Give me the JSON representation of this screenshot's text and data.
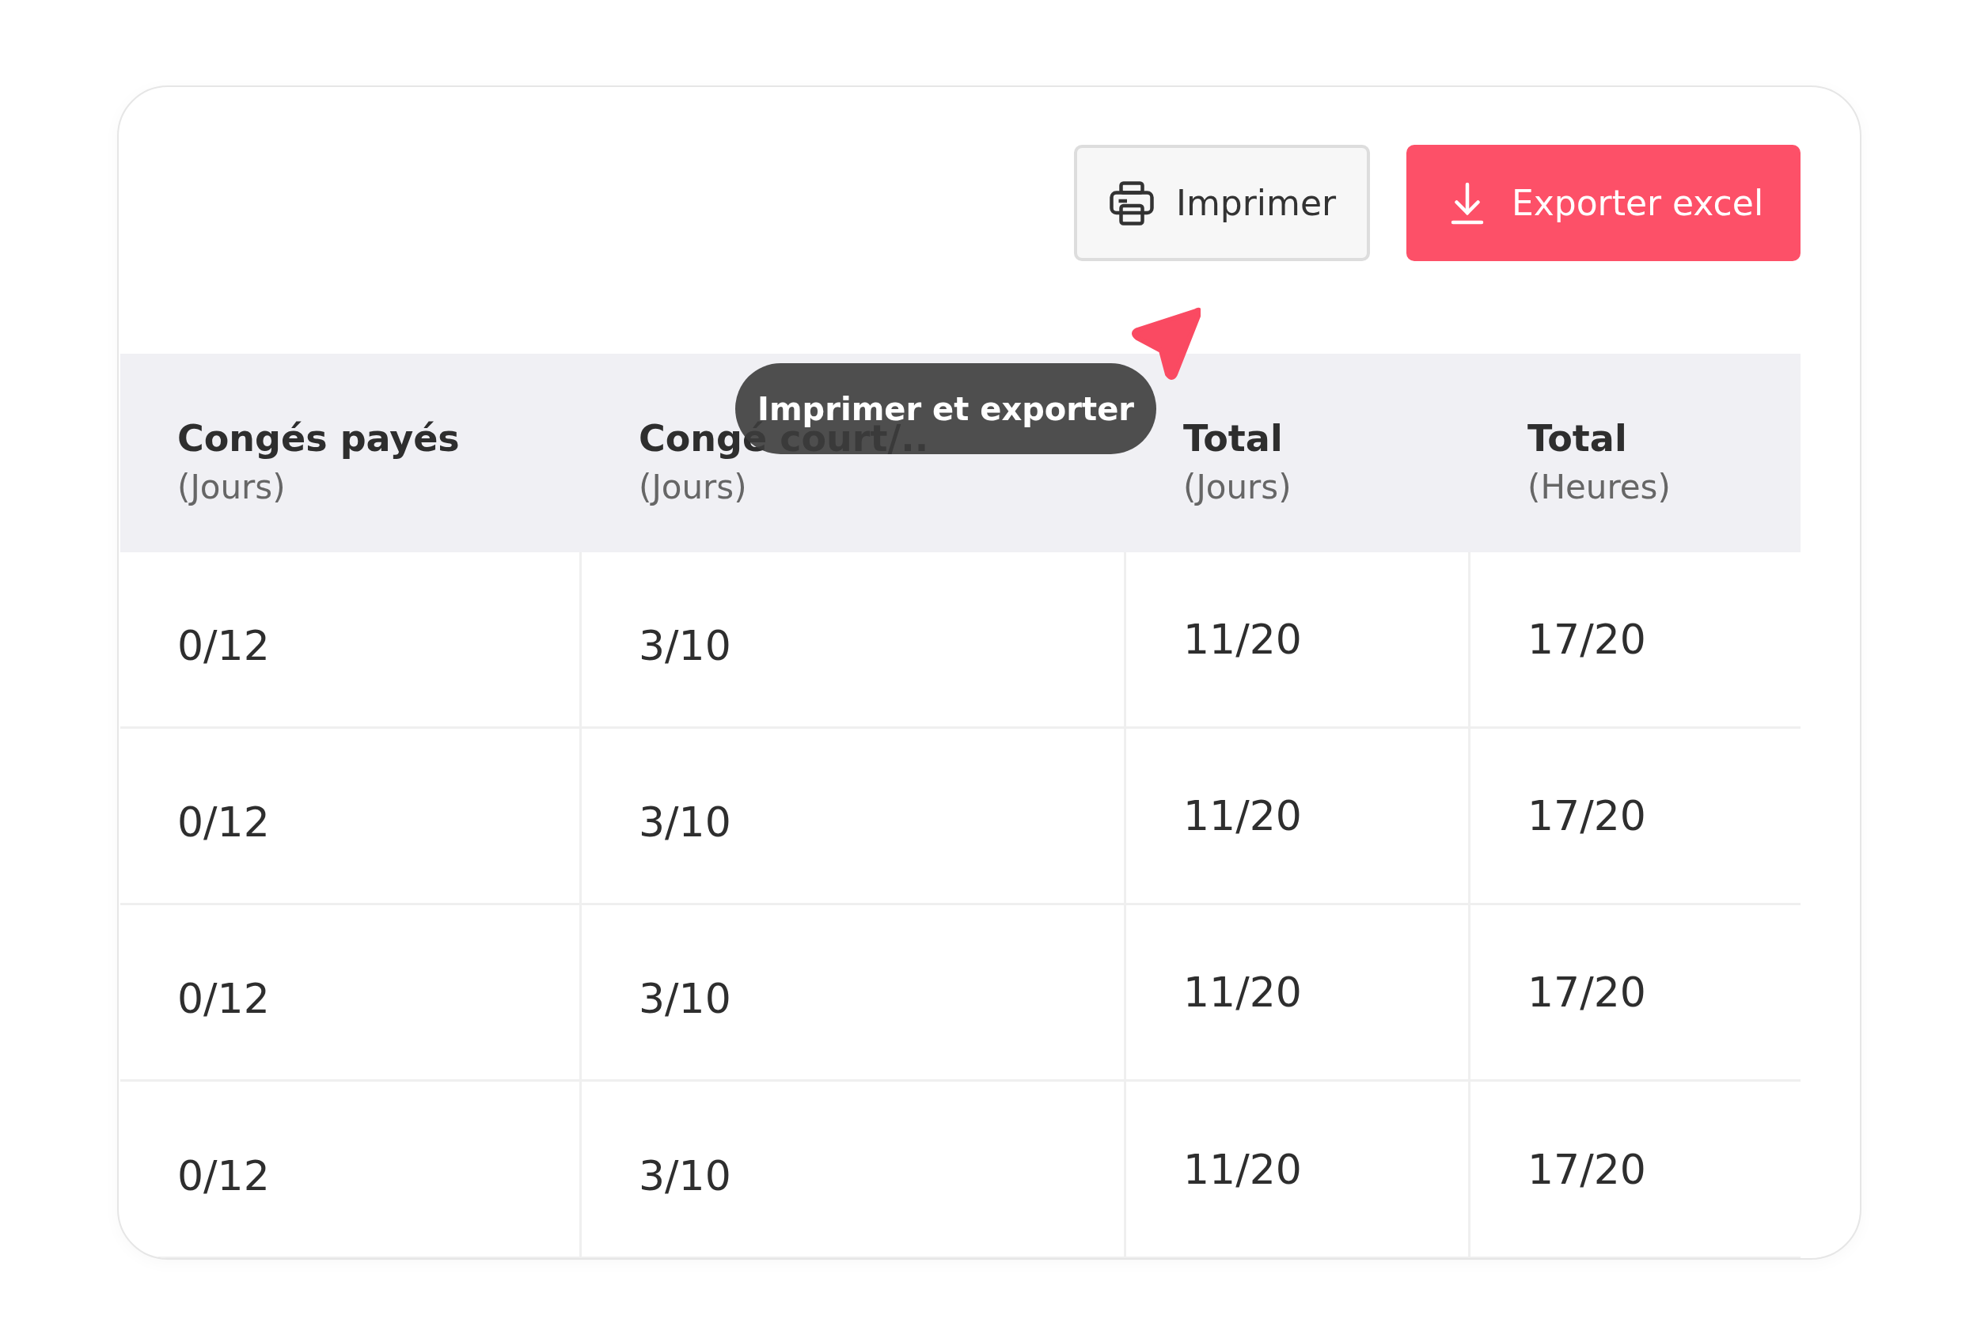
{
  "toolbar": {
    "buttons": [
      {
        "kind": "print",
        "label": "Imprimer"
      },
      {
        "kind": "export",
        "label": "Exporter excel"
      }
    ]
  },
  "table": {
    "columns": [
      {
        "title": "Congés payés",
        "unit": "(Jours)"
      },
      {
        "title": "Congé court/..",
        "unit": "(Jours)"
      },
      {
        "title": "Total",
        "unit": "(Jours)"
      },
      {
        "title": "Total",
        "unit": "(Heures)"
      }
    ],
    "rows": [
      [
        "0/12",
        "3/10",
        "11/20",
        "17/20"
      ],
      [
        "0/12",
        "3/10",
        "11/20",
        "17/20"
      ],
      [
        "0/12",
        "3/10",
        "11/20",
        "17/20"
      ],
      [
        "0/12",
        "3/10",
        "11/20",
        "17/20"
      ]
    ]
  },
  "tooltip": {
    "text": "Imprimer et exporter"
  }
}
